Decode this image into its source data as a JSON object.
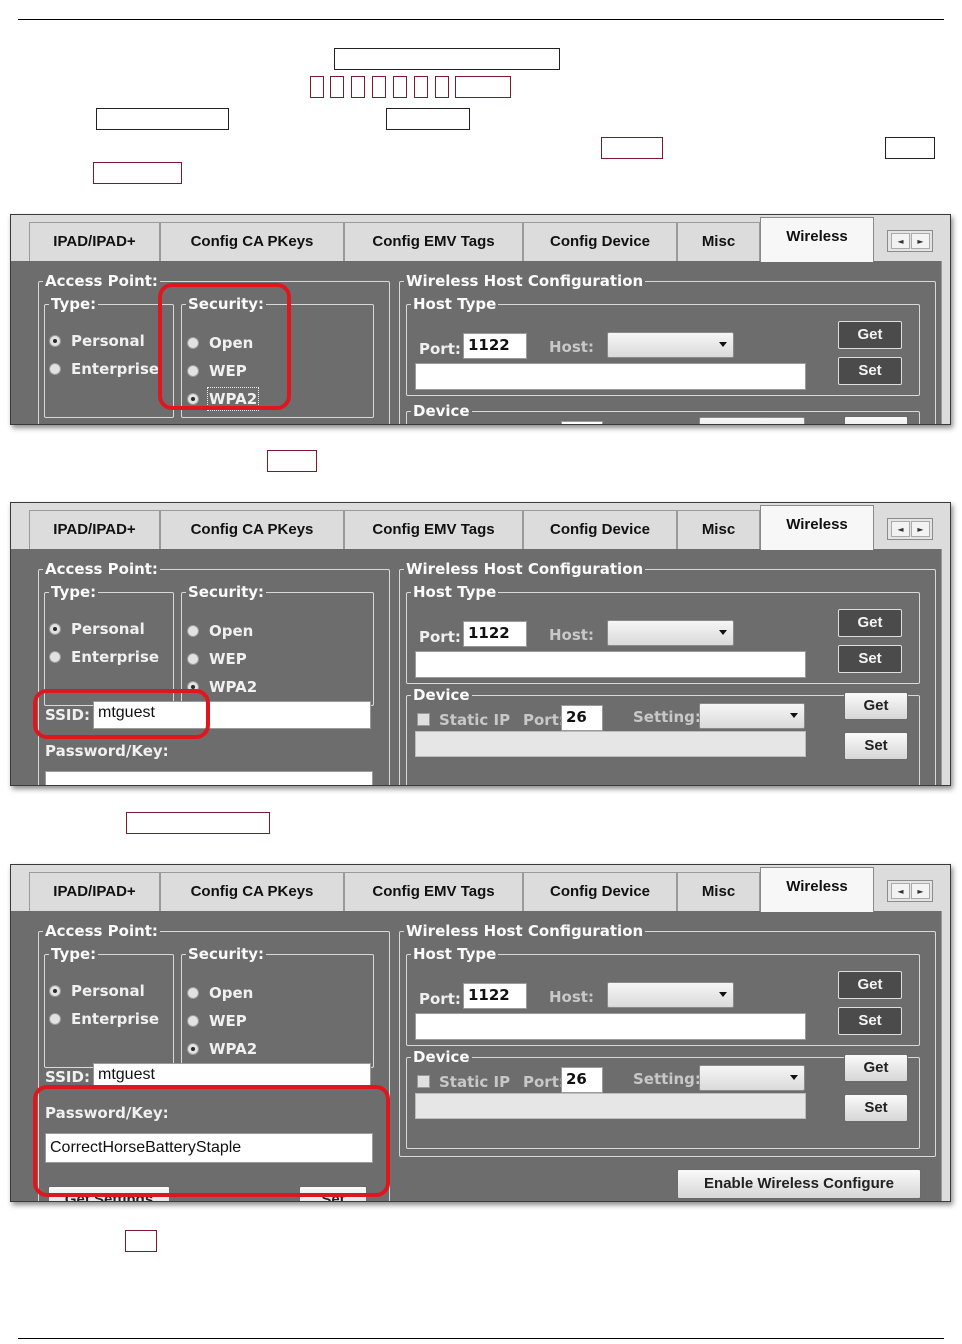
{
  "tabs": [
    "IPAD/IPAD+",
    "Config CA PKeys",
    "Config EMV Tags",
    "Config Device",
    "Misc",
    "Wireless"
  ],
  "tab_arrows": {
    "left": "◄",
    "right": "►"
  },
  "access_point": {
    "title": "Access Point:",
    "type_title": "Type:",
    "type_options": [
      "Personal",
      "Enterprise"
    ],
    "type_selected": "Personal",
    "security_title": "Security:",
    "security_options": [
      "Open",
      "WEP",
      "WPA2"
    ],
    "security_selected": "WPA2",
    "ssid_label": "SSID:",
    "ssid_value": "mtguest",
    "password_label": "Password/Key:",
    "password_value": "CorrectHorseBatteryStaple"
  },
  "wireless_host": {
    "title": "Wireless Host Configuration",
    "host_type_title": "Host Type",
    "port_label": "Port:",
    "port_value": "1122",
    "host_label": "Host:",
    "get_label": "Get",
    "set_label": "Set"
  },
  "device": {
    "title": "Device",
    "static_ip_label": "Static IP",
    "port_label": "Port:",
    "port_value": "26",
    "setting_label": "Setting:",
    "get_label": "Get",
    "set_label": "Set"
  },
  "bottom_buttons": {
    "get_settings": "Get Settings",
    "set": "Set",
    "enable_wireless": "Enable Wireless Configure"
  },
  "colors": {
    "highlight": "#e0161e",
    "panel_bg": "#6d6d6d"
  }
}
